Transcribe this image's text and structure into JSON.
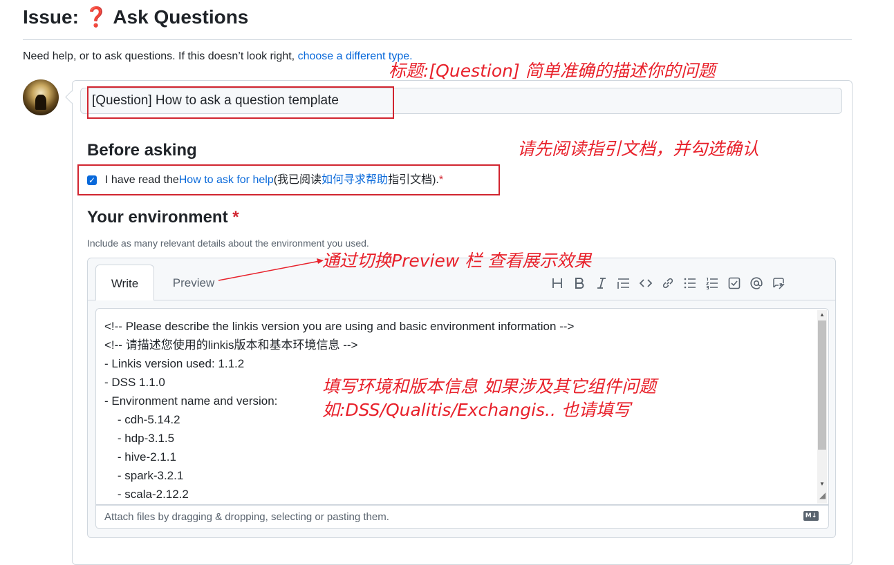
{
  "header": {
    "prefix": "Issue: ",
    "emoji": "❓",
    "title": "Ask Questions",
    "subtitle": "Need help, or to ask questions. If this doesn’t look right, ",
    "subtitle_link": "choose a different type."
  },
  "form": {
    "title_value": "[Question] How to ask a question template",
    "before_heading": "Before asking",
    "checkbox_checked": true,
    "checkbox_text_1": "I have read the ",
    "checkbox_link_1": "How to ask for help",
    "checkbox_text_2": " (我已阅读",
    "checkbox_link_2": "如何寻求帮助",
    "checkbox_text_3": "指引文档). ",
    "required_mark": "*",
    "env_heading": "Your environment",
    "env_hint": "Include as many relevant details about the environment you used.",
    "tabs": [
      "Write",
      "Preview"
    ],
    "toolbar_icons": [
      "heading-icon",
      "bold-icon",
      "italic-icon",
      "quote-icon",
      "code-icon",
      "link-icon",
      "bulleted-list-icon",
      "numbered-list-icon",
      "task-list-icon",
      "mention-icon",
      "reference-icon"
    ],
    "textarea_value": "<!-- Please describe the linkis version you are using and basic environment information -->\n<!-- 请描述您使用的linkis版本和基本环境信息 -->\n- Linkis version used: 1.1.2\n- DSS 1.1.0\n- Environment name and version:\n    - cdh-5.14.2\n    - hdp-3.1.5\n    - hive-2.1.1\n    - spark-3.2.1\n    - scala-2.12.2",
    "attach_text": "Attach files by dragging & dropping, selecting or pasting them.",
    "markdown_badge": "M↓"
  },
  "annotations": {
    "title_note": "标题:[Question] 简单准确的描述你的问题",
    "checkbox_note": "请先阅读指引文档，并勾选确认",
    "preview_note": "通过切换Preview 栏 查看展示效果",
    "env_note_1": "填写环境和版本信息 如果涉及其它组件问题",
    "env_note_2": "如:DSS/Qualitis/Exchangis.. 也请填写"
  },
  "colors": {
    "annotation_red": "#e8212b",
    "link_blue": "#0969da",
    "required_red": "#d1242f"
  }
}
